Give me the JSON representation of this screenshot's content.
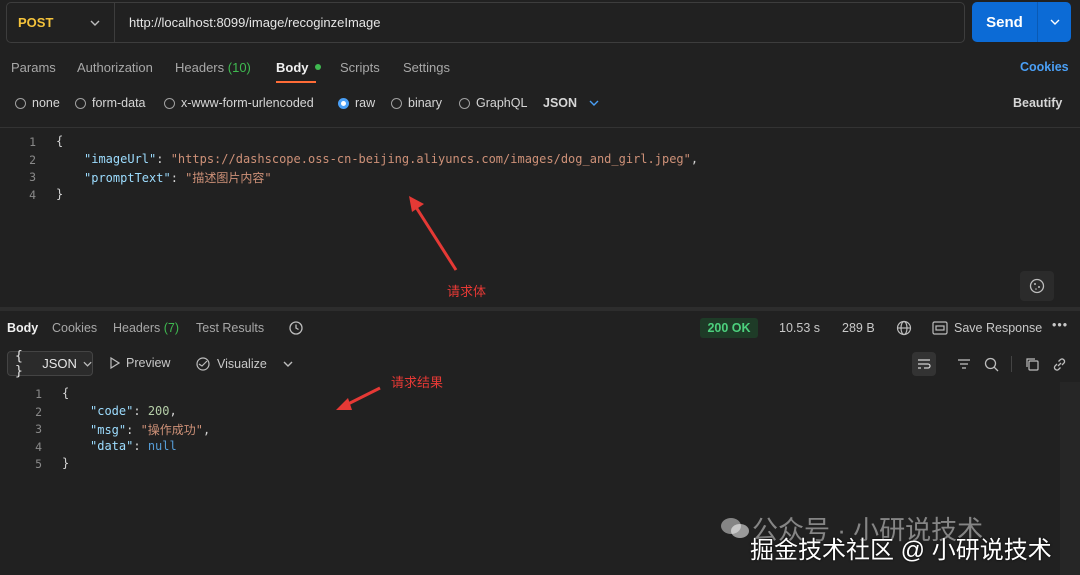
{
  "request": {
    "method": "POST",
    "url": "http://localhost:8099/image/recoginzeImage",
    "send_label": "Send"
  },
  "req_tabs": {
    "params": "Params",
    "authorization": "Authorization",
    "headers": "Headers",
    "headers_count": "(10)",
    "body": "Body",
    "scripts": "Scripts",
    "settings": "Settings",
    "cookies": "Cookies"
  },
  "body_modes": {
    "none": "none",
    "form_data": "form-data",
    "urlencoded": "x-www-form-urlencoded",
    "raw": "raw",
    "binary": "binary",
    "graphql": "GraphQL",
    "format": "JSON",
    "beautify": "Beautify"
  },
  "request_body": {
    "line_numbers": [
      "1",
      "2",
      "3",
      "4"
    ],
    "open_brace": "{",
    "close_brace": "}",
    "key1": "\"imageUrl\"",
    "val1": "\"https://dashscope.oss-cn-beijing.aliyuncs.com/images/dog_and_girl.jpeg\"",
    "key2": "\"promptText\"",
    "val2": "\"描述图片内容\"",
    "annotation": "请求体"
  },
  "resp_tabs": {
    "body": "Body",
    "cookies": "Cookies",
    "headers": "Headers",
    "headers_count": "(7)",
    "test_results": "Test Results"
  },
  "response_meta": {
    "status": "200 OK",
    "time": "10.53 s",
    "size": "289 B",
    "save_response": "Save Response"
  },
  "resp_toolbar": {
    "format": "JSON",
    "preview": "Preview",
    "visualize": "Visualize"
  },
  "response_body": {
    "line_numbers": [
      "1",
      "2",
      "3",
      "4",
      "5"
    ],
    "open_brace": "{",
    "close_brace": "}",
    "key1": "\"code\"",
    "val1": "200",
    "key2": "\"msg\"",
    "val2": "\"操作成功\"",
    "key3": "\"data\"",
    "val3": "null",
    "annotation": "请求结果"
  },
  "watermark": {
    "line1": "公众号 · 小研说技术",
    "line2": "掘金技术社区 @ 小研说技术"
  },
  "colors": {
    "accent_send": "#0c6bd6",
    "method_post": "#f5c33b",
    "tab_underline": "#ff6c37",
    "status_ok": "#4cd07d",
    "annotation_red": "#e53935"
  }
}
